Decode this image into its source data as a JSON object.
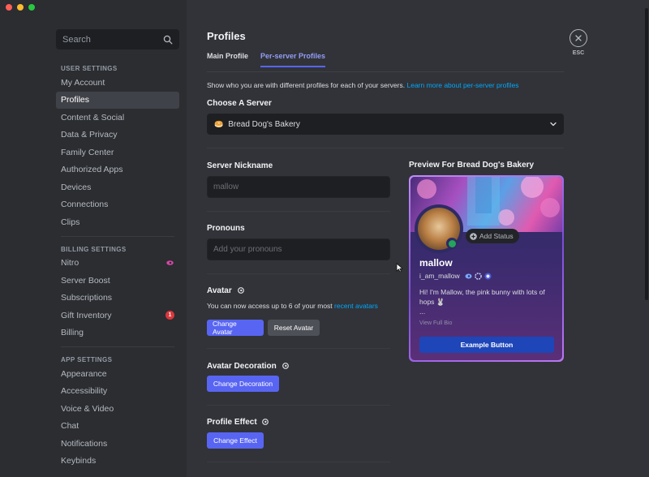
{
  "search": {
    "placeholder": "Search"
  },
  "sidebar": {
    "sections": [
      {
        "header": "USER SETTINGS",
        "items": [
          "My Account",
          "Profiles",
          "Content & Social",
          "Data & Privacy",
          "Family Center",
          "Authorized Apps",
          "Devices",
          "Connections",
          "Clips"
        ]
      },
      {
        "header": "BILLING SETTINGS",
        "items": [
          "Nitro",
          "Server Boost",
          "Subscriptions",
          "Gift Inventory",
          "Billing"
        ]
      },
      {
        "header": "APP SETTINGS",
        "items": [
          "Appearance",
          "Accessibility",
          "Voice & Video",
          "Chat",
          "Notifications",
          "Keybinds"
        ]
      }
    ],
    "active_item": "Profiles",
    "gift_badge_count": "1"
  },
  "header": {
    "title": "Profiles",
    "tabs": [
      "Main Profile",
      "Per-server Profiles"
    ],
    "active_tab": "Per-server Profiles",
    "esc_label": "ESC"
  },
  "main": {
    "description": "Show who you are with different profiles for each of your servers.",
    "learn_more": "Learn more about per-server profiles",
    "choose_server_label": "Choose A Server",
    "server_name": "Bread Dog's Bakery",
    "server_emoji": "🥯",
    "nickname_label": "Server Nickname",
    "nickname_placeholder": "mallow",
    "pronouns_label": "Pronouns",
    "pronouns_placeholder": "Add your pronouns",
    "avatar_label": "Avatar",
    "avatar_desc": "You can now access up to 6 of your most",
    "avatar_desc_link": "recent avatars",
    "change_avatar": "Change Avatar",
    "reset_avatar": "Reset Avatar",
    "decoration_label": "Avatar Decoration",
    "change_decoration": "Change Decoration",
    "effect_label": "Profile Effect",
    "change_effect": "Change Effect"
  },
  "preview": {
    "label": "Preview For Bread Dog's Bakery",
    "add_status": "Add Status",
    "display_name": "mallow",
    "username": "i_am_mallow",
    "bio_line1": "Hi! I'm Mallow, the pink bunny with lots of",
    "bio_line2": "hops 🐰",
    "bio_more": "...",
    "view_full_bio": "View Full Bio",
    "example_button": "Example Button"
  },
  "colors": {
    "accent": "#5865f2",
    "link": "#00a8fc",
    "online": "#23a55a",
    "badge": "#da373c"
  }
}
